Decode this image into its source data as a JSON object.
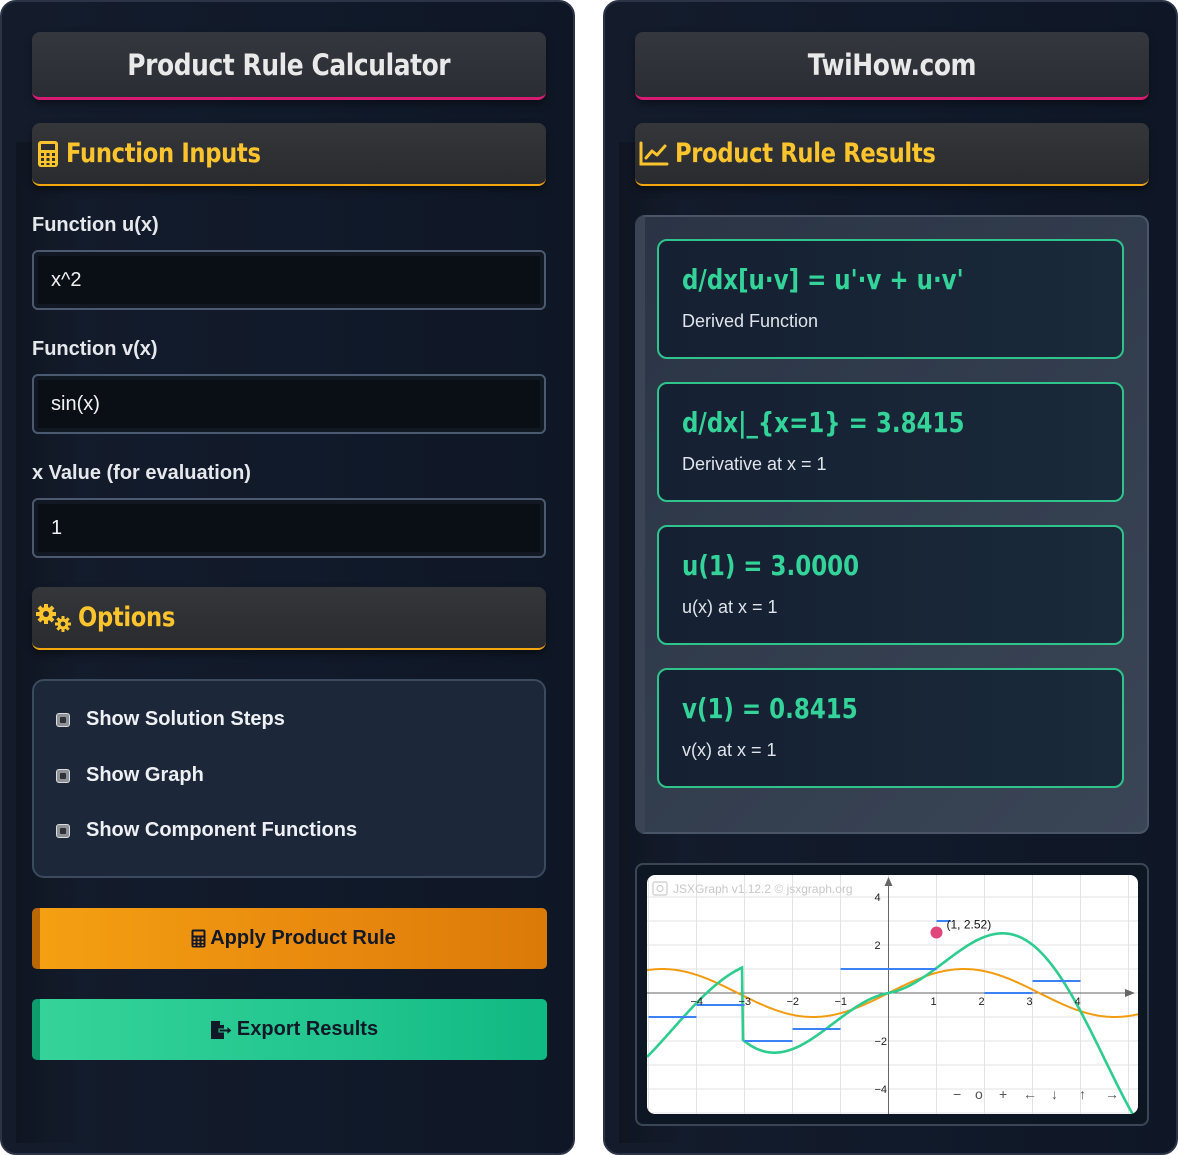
{
  "left_panel": {
    "title": "Product Rule Calculator",
    "inputs_heading": "Function Inputs",
    "u_label": "Function u(x)",
    "u_value": "x^2",
    "v_label": "Function v(x)",
    "v_value": "sin(x)",
    "x_label": "x Value (for evaluation)",
    "x_value": "1",
    "options_heading": "Options",
    "options": [
      {
        "label": "Show Solution Steps",
        "checked": true
      },
      {
        "label": "Show Graph",
        "checked": true
      },
      {
        "label": "Show Component Functions",
        "checked": true
      }
    ],
    "apply_button": "Apply Product Rule",
    "export_button": "Export Results"
  },
  "right_panel": {
    "title": "TwiHow.com",
    "results_heading": "Product Rule Results",
    "results": [
      {
        "value": "d/dx[u·v] = u'·v + u·v'",
        "desc": "Derived Function"
      },
      {
        "value": "d/dx|_{x=1} = 3.8415",
        "desc": "Derivative at x = 1"
      },
      {
        "value": "u(1) = 3.0000",
        "desc": "u(x) at x = 1"
      },
      {
        "value": "v(1) = 0.8415",
        "desc": "v(x) at x = 1"
      }
    ]
  },
  "graph": {
    "watermark": "JSXGraph v1.12.2 © jsxgraph.org",
    "point_label": "(1, 2.52)",
    "x_ticks": [
      "−4",
      "−3",
      "−2",
      "−1",
      "1",
      "2",
      "3",
      "4"
    ],
    "y_ticks": [
      "4",
      "2",
      "−2",
      "−4"
    ],
    "nav_controls": [
      "−",
      "o",
      "+",
      "←",
      "↓",
      "↑",
      "→"
    ],
    "colors": {
      "product": "#2ecc8f",
      "v_function": "#f39c12",
      "derivative": "#3b82f6",
      "point": "#e0457b"
    }
  }
}
